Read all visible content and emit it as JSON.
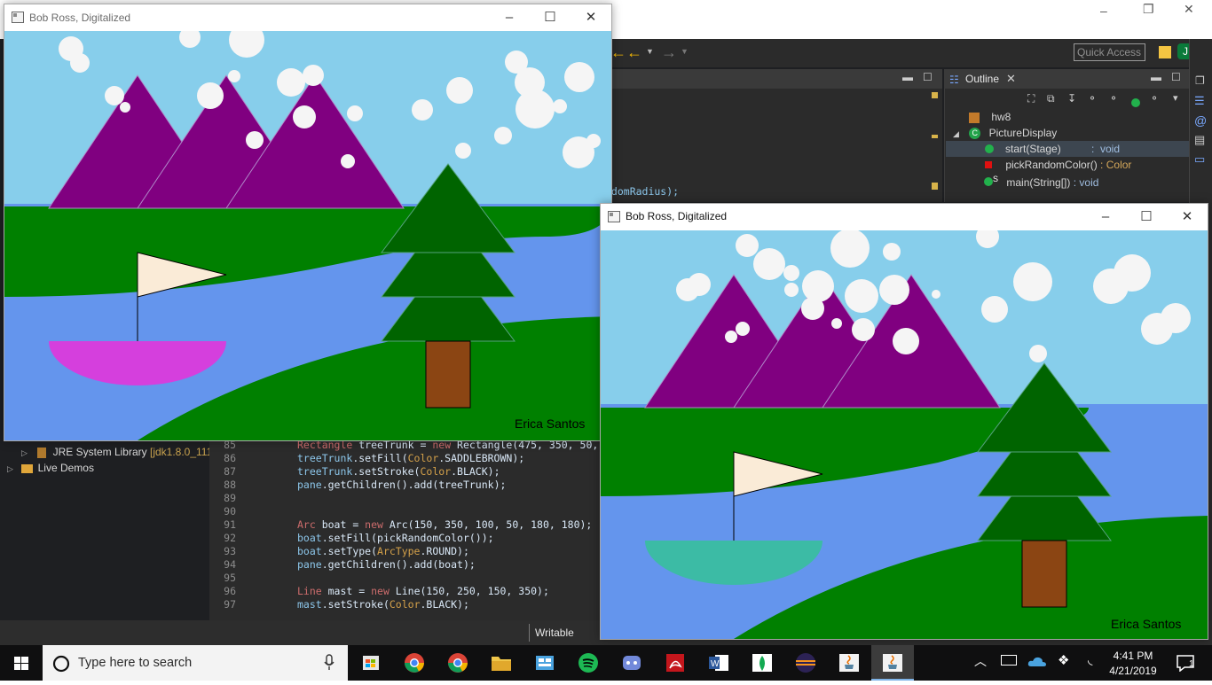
{
  "ide": {
    "quick_access_placeholder": "Quick Access",
    "outline": {
      "tab_label": "Outline",
      "items": [
        {
          "label": "hw8"
        },
        {
          "label": "PictureDisplay"
        },
        {
          "label": "start(Stage) : void",
          "name": "start(Stage)",
          "sep": " : ",
          "type": "void"
        },
        {
          "name": "pickRandomColor()",
          "sep": " : ",
          "type": "Color"
        },
        {
          "name": "main(String[])",
          "sep": " : ",
          "type": "void"
        }
      ],
      "static_marker": "S"
    },
    "editor_snippet": "ndomRadius);",
    "package_explorer": {
      "jre_label": "JRE System Library",
      "jre_version": "[jdk1.8.0_111]",
      "live_demos": "Live Demos"
    },
    "code_lines": [
      {
        "n": "85",
        "parts": [
          [
            "kw",
            "Rectangle "
          ],
          [
            "",
            "treeTrunk = "
          ],
          [
            "kw",
            "new "
          ],
          [
            "",
            "Rectangle(475, 350, 50,"
          ]
        ]
      },
      {
        "n": "86",
        "parts": [
          [
            "m",
            "treeTrunk"
          ],
          [
            "",
            ".setFill("
          ],
          [
            "t",
            "Color"
          ],
          [
            "",
            ".SADDLEBROWN);"
          ]
        ]
      },
      {
        "n": "87",
        "parts": [
          [
            "m",
            "treeTrunk"
          ],
          [
            "",
            ".setStroke("
          ],
          [
            "t",
            "Color"
          ],
          [
            "",
            ".BLACK);"
          ]
        ]
      },
      {
        "n": "88",
        "parts": [
          [
            "m",
            "pane"
          ],
          [
            "",
            ".getChildren().add(treeTrunk);"
          ]
        ]
      },
      {
        "n": "89",
        "parts": []
      },
      {
        "n": "90",
        "parts": []
      },
      {
        "n": "91",
        "parts": [
          [
            "kw",
            "Arc "
          ],
          [
            "",
            "boat = "
          ],
          [
            "kw",
            "new "
          ],
          [
            "",
            "Arc(150, 350, 100, 50, 180, 180);"
          ]
        ]
      },
      {
        "n": "92",
        "parts": [
          [
            "m",
            "boat"
          ],
          [
            "",
            ".setFill(pickRandomColor());"
          ]
        ]
      },
      {
        "n": "93",
        "parts": [
          [
            "m",
            "boat"
          ],
          [
            "",
            ".setType("
          ],
          [
            "t",
            "ArcType"
          ],
          [
            "",
            ".ROUND);"
          ]
        ]
      },
      {
        "n": "94",
        "parts": [
          [
            "m",
            "pane"
          ],
          [
            "",
            ".getChildren().add(boat);"
          ]
        ]
      },
      {
        "n": "95",
        "parts": []
      },
      {
        "n": "96",
        "parts": [
          [
            "kw",
            "Line "
          ],
          [
            "",
            "mast = "
          ],
          [
            "kw",
            "new "
          ],
          [
            "",
            "Line(150, 250, 150, 350);"
          ]
        ]
      },
      {
        "n": "97",
        "parts": [
          [
            "m",
            "mast"
          ],
          [
            "",
            ".setStroke("
          ],
          [
            "t",
            "Color"
          ],
          [
            "",
            ".BLACK);"
          ]
        ]
      }
    ],
    "status": {
      "writable": "Writable"
    }
  },
  "window1": {
    "title": "Bob Ross, Digitalized",
    "signature": "Erica Santos",
    "boat_color": "#d53fdd",
    "controls": {
      "minimize": "–",
      "maximize": "☐",
      "close": "✕"
    }
  },
  "window2": {
    "title": "Bob Ross, Digitalized",
    "signature": "Erica Santos",
    "boat_color": "#3cbba5",
    "controls": {
      "minimize": "–",
      "maximize": "☐",
      "close": "✕"
    }
  },
  "colors": {
    "sky": "#87ceeb",
    "water": "#6495ed",
    "grass": "#008000",
    "mountain": "#800080",
    "tree": "#006400",
    "trunk": "#8b4513",
    "flag": "#faebd7",
    "taskbar": "#0f0f10"
  },
  "taskbar": {
    "search_placeholder": "Type here to search",
    "apps": [
      "store-icon",
      "chrome-icon",
      "chrome-icon-2",
      "file-explorer-icon",
      "control-panel-icon",
      "spotify-icon",
      "discord-icon",
      "acrobat-icon",
      "word-icon",
      "mongodb-icon",
      "eclipse-icon",
      "java-icon",
      "java-app-icon"
    ],
    "clock_time": "4:41 PM",
    "clock_date": "4/21/2019",
    "notification_count": "1"
  }
}
